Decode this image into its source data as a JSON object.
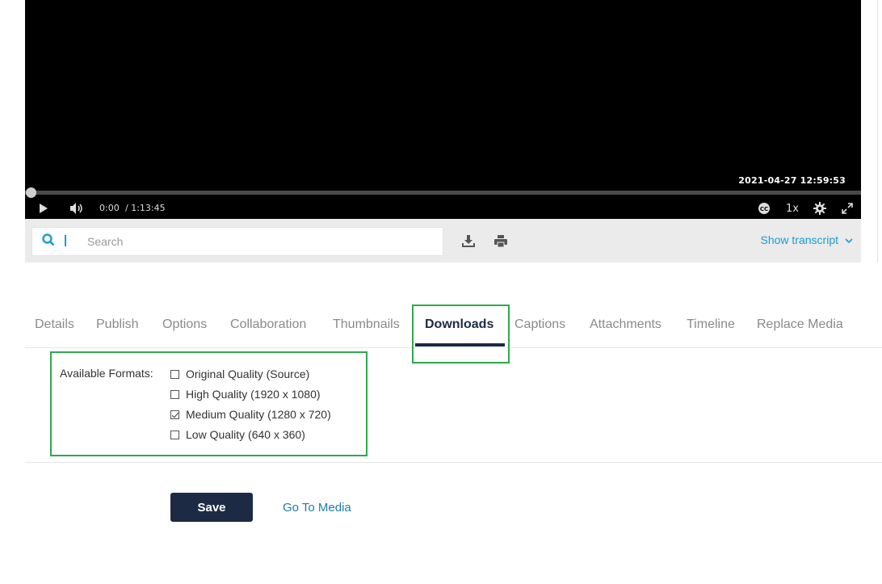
{
  "player": {
    "timestamp": "2021-04-27 12:59:53",
    "current_time": "0:00",
    "total_time": "/ 1:13:45",
    "playback_rate": "1x",
    "progress": 0.0
  },
  "transcript_bar": {
    "search_placeholder": "Search",
    "show_transcript": "Show transcript"
  },
  "tabs": [
    {
      "label": "Details"
    },
    {
      "label": "Publish"
    },
    {
      "label": "Options"
    },
    {
      "label": "Collaboration"
    },
    {
      "label": "Thumbnails"
    },
    {
      "label": "Downloads",
      "active": true
    },
    {
      "label": "Captions"
    },
    {
      "label": "Attachments"
    },
    {
      "label": "Timeline"
    },
    {
      "label": "Replace Media"
    }
  ],
  "downloads": {
    "label": "Available Formats:",
    "options": [
      {
        "label": "Original Quality (Source)",
        "checked": false
      },
      {
        "label": "High Quality (1920 x 1080)",
        "checked": false
      },
      {
        "label": "Medium Quality (1280 x 720)",
        "checked": true
      },
      {
        "label": "Low Quality (640 x 360)",
        "checked": false
      }
    ]
  },
  "actions": {
    "save_label": "Save",
    "goto_label": "Go To Media"
  },
  "colors": {
    "accent": "#1a9bd7",
    "primary": "#1d2a44",
    "highlight": "#2ea94e"
  }
}
